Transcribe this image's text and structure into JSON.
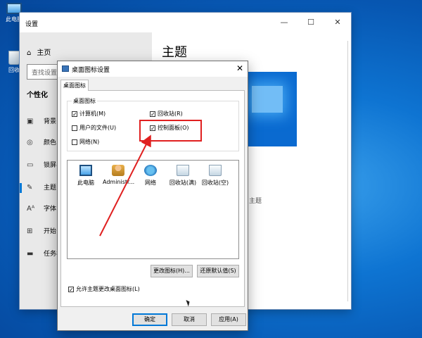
{
  "desktop": {
    "icons": [
      {
        "label": "此电脑",
        "icon": "computer-icon"
      },
      {
        "label": "回收",
        "icon": "recycle-bin-icon"
      }
    ]
  },
  "settings": {
    "title": "设置",
    "controls": {
      "minimize": "—",
      "maximize": "☐",
      "close": "✕"
    },
    "home": "主页",
    "search_placeholder": "查找设置",
    "section": "个性化",
    "nav": [
      {
        "label": "背景",
        "icon": "image-icon"
      },
      {
        "label": "颜色",
        "icon": "palette-icon"
      },
      {
        "label": "锁屏界",
        "icon": "lockscreen-icon"
      },
      {
        "label": "主题",
        "icon": "theme-icon",
        "active": true
      },
      {
        "label": "字体",
        "icon": "font-icon"
      },
      {
        "label": "开始",
        "icon": "start-icon"
      },
      {
        "label": "任务栏",
        "icon": "taskbar-icon"
      }
    ],
    "page_title": "主题",
    "partial_text": "主题"
  },
  "dialog": {
    "title": "桌面图标设置",
    "tab": "桌面图标",
    "group_label": "桌面图标",
    "checkboxes": [
      {
        "label": "计算机(M)",
        "checked": true
      },
      {
        "label": "回收站(R)",
        "checked": true
      },
      {
        "label": "用户的文件(U)",
        "checked": false
      },
      {
        "label": "控制面板(O)",
        "checked": true
      },
      {
        "label": "网络(N)",
        "checked": false
      }
    ],
    "icons": [
      {
        "label": "此电脑",
        "icon": "computer-icon"
      },
      {
        "label": "Administr...",
        "icon": "user-folder-icon"
      },
      {
        "label": "网络",
        "icon": "network-icon"
      },
      {
        "label": "回收站(满)",
        "icon": "recycle-bin-full-icon"
      },
      {
        "label": "回收站(空)",
        "icon": "recycle-bin-empty-icon"
      }
    ],
    "change_icon_button": "更改图标(H)...",
    "restore_default_button": "还原默认值(S)",
    "allow_themes_checkbox": {
      "label": "允许主题更改桌面图标(L)",
      "checked": true
    },
    "ok_button": "确定",
    "cancel_button": "取消",
    "apply_button": "应用(A)"
  },
  "annotation": {
    "color": "#e02020"
  }
}
